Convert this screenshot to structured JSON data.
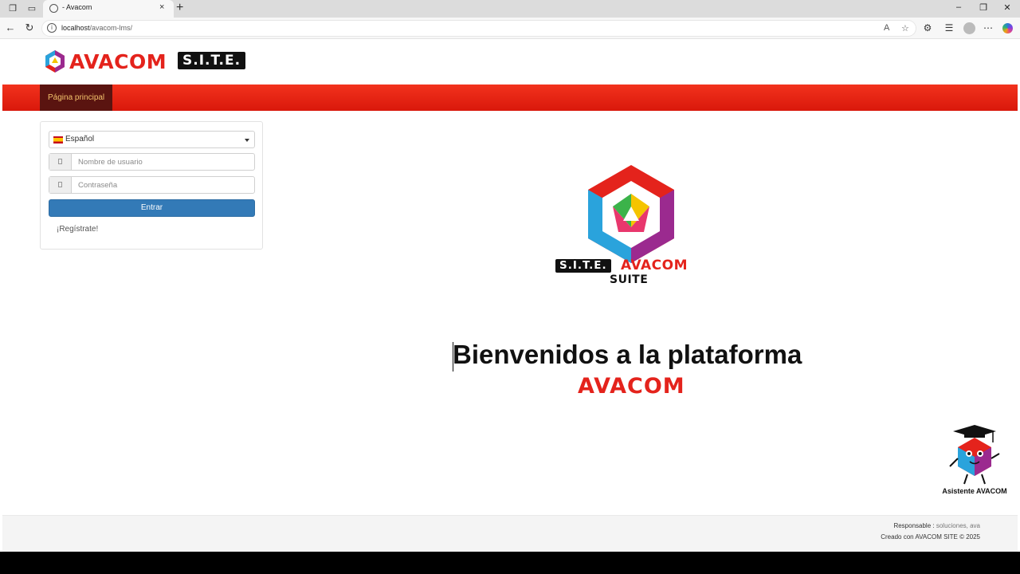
{
  "browser": {
    "tab_title": "- Avacom",
    "tab_close": "×",
    "new_tab": "+",
    "url_host": "localhost",
    "url_path": "/avacom-lms/",
    "icons": [
      "workspaces-icon",
      "tab-actions-icon",
      "back-icon",
      "refresh-icon",
      "read-aloud-icon",
      "favorite-star-icon",
      "extensions-icon",
      "favorites-icon",
      "profile-avatar",
      "more-menu-icon",
      "copilot-icon"
    ]
  },
  "header": {
    "logo_word": "AVACOM",
    "logo_site": "S.I.T.E."
  },
  "nav": {
    "home_label": "Página principal"
  },
  "login": {
    "language": "Español",
    "username_placeholder": "Nombre de usuario",
    "password_placeholder": "Contraseña",
    "submit_label": "Entrar",
    "register_label": "¡Regístrate!"
  },
  "hero": {
    "band_site": "S.I.T.E.",
    "band_avacom": "AVACOM",
    "band_suite": "SUITE",
    "welcome_title": "Bienvenidos a la plataforma",
    "welcome_brand": "AVACOM"
  },
  "assistant": {
    "label": "Asistente AVACOM"
  },
  "footer": {
    "responsible_label": "Responsable :",
    "responsible_value": "soluciones, ava",
    "created_label": "Creado con AVACOM SITE © 2025"
  },
  "colors": {
    "brand_red": "#e4231c",
    "nav_active_bg": "#5a1410",
    "nav_active_text": "#f3c26b",
    "button_blue": "#337ab7"
  }
}
